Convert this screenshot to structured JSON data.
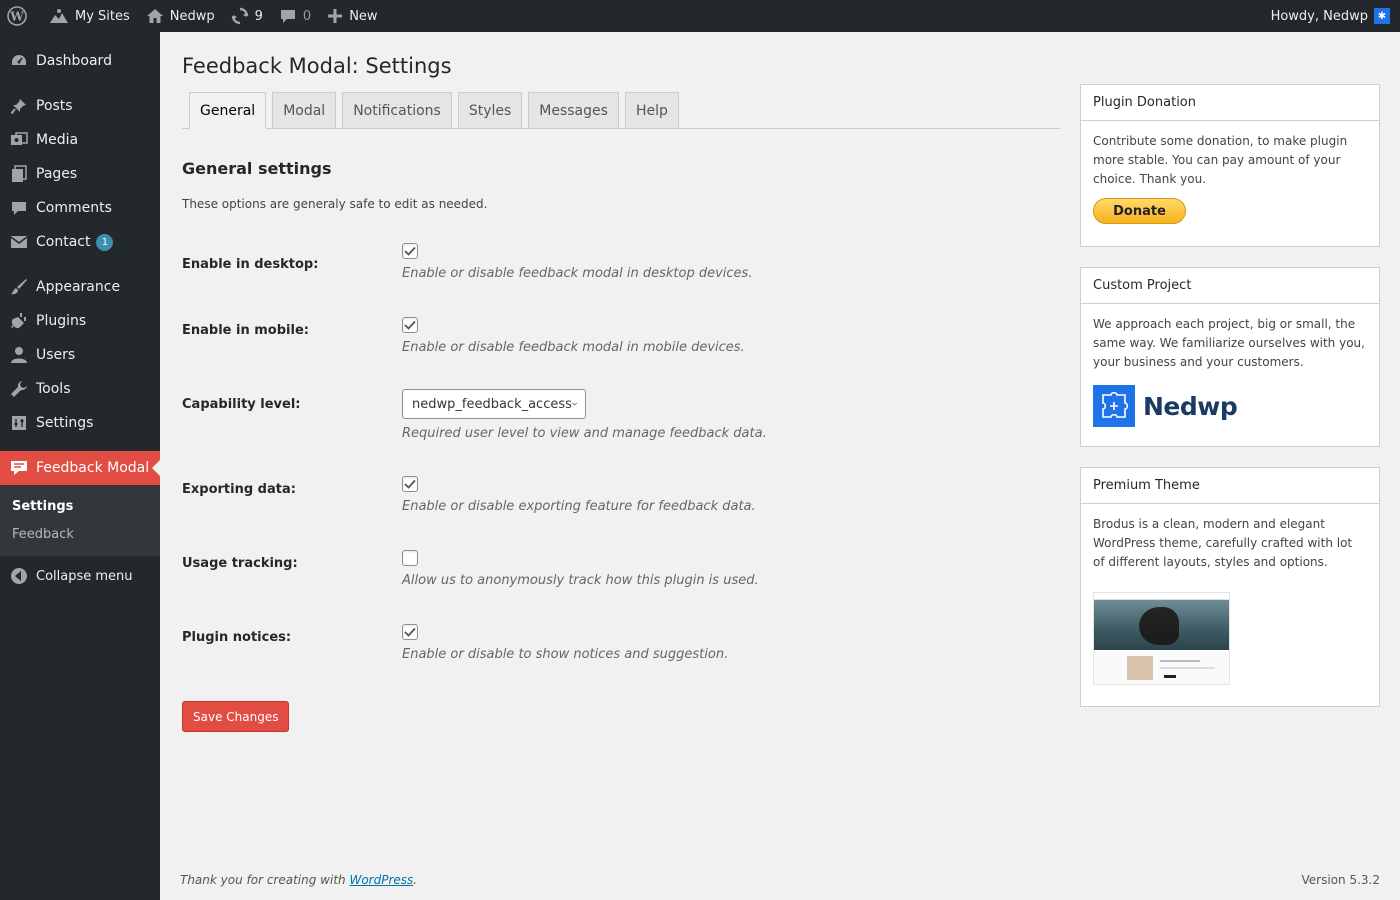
{
  "adminbar": {
    "my_sites": "My Sites",
    "site_name": "Nedwp",
    "updates_count": "9",
    "comments_count": "0",
    "new_label": "New",
    "howdy": "Howdy, Nedwp"
  },
  "sidebar": {
    "items": [
      {
        "label": "Dashboard",
        "icon": "dashboard-icon"
      },
      {
        "label": "Posts",
        "icon": "pin-icon"
      },
      {
        "label": "Media",
        "icon": "media-icon"
      },
      {
        "label": "Pages",
        "icon": "pages-icon"
      },
      {
        "label": "Comments",
        "icon": "comment-icon"
      },
      {
        "label": "Contact",
        "icon": "mail-icon",
        "badge": "1"
      },
      {
        "label": "Appearance",
        "icon": "brush-icon"
      },
      {
        "label": "Plugins",
        "icon": "plugin-icon"
      },
      {
        "label": "Users",
        "icon": "user-icon"
      },
      {
        "label": "Tools",
        "icon": "wrench-icon"
      },
      {
        "label": "Settings",
        "icon": "settings-icon"
      },
      {
        "label": "Feedback Modal",
        "icon": "feedback-icon"
      }
    ],
    "submenu": [
      "Settings",
      "Feedback"
    ],
    "collapse": "Collapse menu"
  },
  "page": {
    "title": "Feedback Modal: Settings",
    "tabs": [
      "General",
      "Modal",
      "Notifications",
      "Styles",
      "Messages",
      "Help"
    ],
    "active_tab": "General",
    "section_title": "General settings",
    "section_desc": "These options are generaly safe to edit as needed.",
    "fields": [
      {
        "label": "Enable in desktop:",
        "type": "checkbox",
        "checked": true,
        "desc": "Enable or disable feedback modal in desktop devices."
      },
      {
        "label": "Enable in mobile:",
        "type": "checkbox",
        "checked": true,
        "desc": "Enable or disable feedback modal in mobile devices."
      },
      {
        "label": "Capability level:",
        "type": "select",
        "value": "nedwp_feedback_access",
        "desc": "Required user level to view and manage feedback data."
      },
      {
        "label": "Exporting data:",
        "type": "checkbox",
        "checked": true,
        "desc": "Enable or disable exporting feature for feedback data."
      },
      {
        "label": "Usage tracking:",
        "type": "checkbox",
        "checked": false,
        "desc": "Allow us to anonymously track how this plugin is used."
      },
      {
        "label": "Plugin notices:",
        "type": "checkbox",
        "checked": true,
        "desc": "Enable or disable to show notices and suggestion."
      }
    ],
    "save_label": "Save Changes"
  },
  "boxes": {
    "donation": {
      "title": "Plugin Donation",
      "text": "Contribute some donation, to make plugin more stable. You can pay amount of your choice. Thank you.",
      "button": "Donate"
    },
    "custom": {
      "title": "Custom Project",
      "text": "We approach each project, big or small, the same way. We familiarize ourselves with you, your business and your customers.",
      "logo_text": "Nedwp"
    },
    "premium": {
      "title": "Premium Theme",
      "text": "Brodus is a clean, modern and elegant WordPress theme, carefully crafted with lot of different layouts, styles and options."
    }
  },
  "footer": {
    "thanks_prefix": "Thank you for creating with ",
    "thanks_link": "WordPress",
    "thanks_suffix": ".",
    "version": "Version 5.3.2"
  },
  "colors": {
    "accent": "#e14d43",
    "adminbar": "#23282d",
    "brand_blue": "#1e73e8"
  }
}
